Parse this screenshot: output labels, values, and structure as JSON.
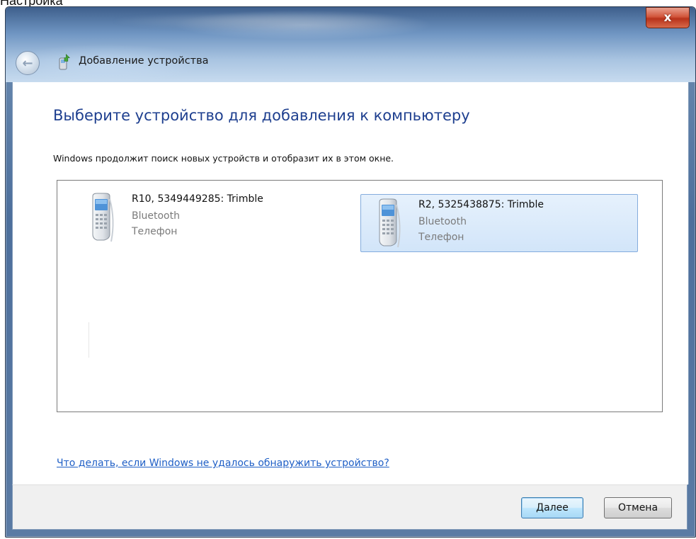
{
  "caption": "Настройка",
  "window": {
    "title": "Добавление устройства",
    "close_label": "x"
  },
  "content": {
    "heading": "Выберите устройство для добавления к компьютеру",
    "instruction": "Windows продолжит поиск новых устройств и отобразит их в этом окне.",
    "devices": [
      {
        "name": "R10, 5349449285: Trimble",
        "connection": "Bluetooth",
        "category": "Телефон",
        "selected": false
      },
      {
        "name": "R2, 5325438875: Trimble",
        "connection": "Bluetooth",
        "category": "Телефон",
        "selected": true
      }
    ],
    "help_link": "Что делать, если Windows не удалось обнаружить устройство?"
  },
  "footer": {
    "next_button": {
      "accel": "Д",
      "rest": "алее"
    },
    "cancel_button": "Отмена"
  },
  "icons": {
    "back": "back-arrow-icon",
    "title": "device-add-icon",
    "device": "mobile-phone-icon"
  },
  "colors": {
    "heading": "#1e3f8f",
    "link": "#1f5fc6",
    "selection_fill": "#d2e5f9",
    "selection_border": "#84acdd"
  }
}
